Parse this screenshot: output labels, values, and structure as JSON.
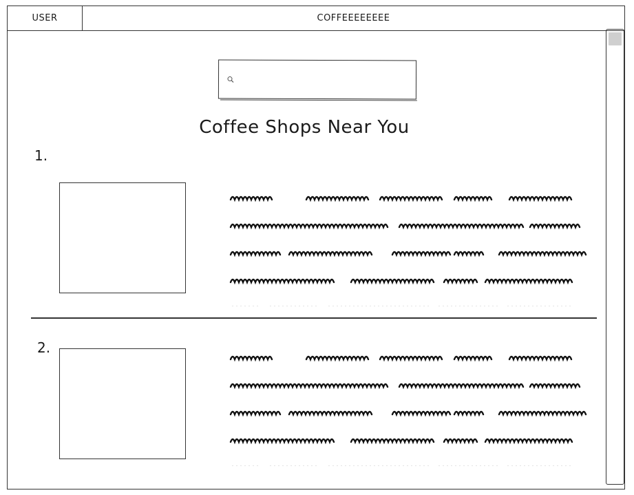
{
  "header": {
    "user_label": "USER",
    "app_title": "COFFEEEEEEEE"
  },
  "search": {
    "placeholder": "",
    "value": "",
    "icon": "search-icon"
  },
  "page_title": "Coffee Shops Near You",
  "list": {
    "items": [
      {
        "number": "1.",
        "image": "image-placeholder",
        "description": "placeholder-text"
      },
      {
        "number": "2.",
        "image": "image-placeholder",
        "description": "placeholder-text"
      }
    ]
  },
  "colors": {
    "ink": "#333333",
    "scroll_thumb": "#cfcfcf"
  }
}
